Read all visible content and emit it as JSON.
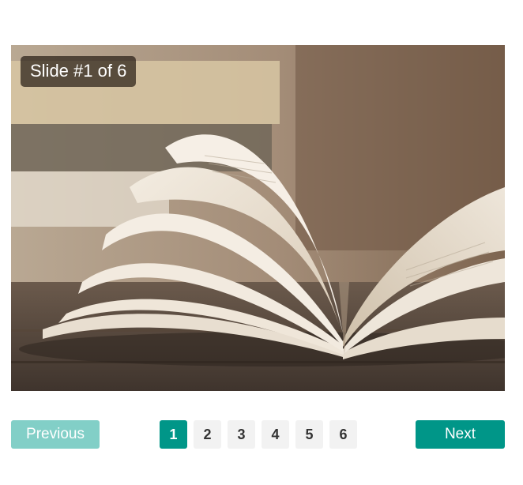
{
  "slideshow": {
    "caption": "Slide #1 of 6",
    "current_page": 1,
    "total_pages": 6
  },
  "controls": {
    "previous_label": "Previous",
    "next_label": "Next"
  },
  "pagination": {
    "pages": [
      {
        "label": "1",
        "active": true
      },
      {
        "label": "2",
        "active": false
      },
      {
        "label": "3",
        "active": false
      },
      {
        "label": "4",
        "active": false
      },
      {
        "label": "5",
        "active": false
      },
      {
        "label": "6",
        "active": false
      }
    ]
  },
  "colors": {
    "accent": "#009688",
    "accent_light": "#82cfc7",
    "page_bg": "#f2f2f2"
  }
}
